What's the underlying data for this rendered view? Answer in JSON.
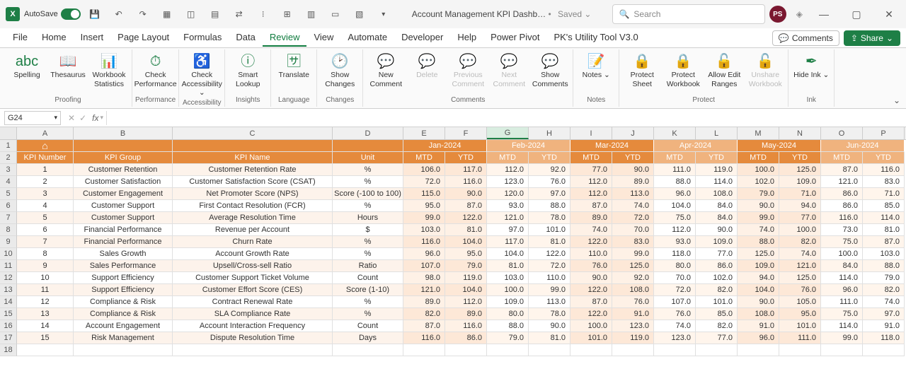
{
  "titlebar": {
    "autosave": "AutoSave",
    "doc": "Account Management KPI Dashb…",
    "saved": "Saved",
    "search_placeholder": "Search",
    "avatar": "PS"
  },
  "tabs": [
    "File",
    "Home",
    "Insert",
    "Page Layout",
    "Formulas",
    "Data",
    "Review",
    "View",
    "Automate",
    "Developer",
    "Help",
    "Power Pivot",
    "PK's Utility Tool V3.0"
  ],
  "active_tab": "Review",
  "right_actions": {
    "comments": "Comments",
    "share": "Share"
  },
  "ribbon": {
    "groups": [
      {
        "label": "Proofing",
        "items": [
          {
            "name": "spelling-button",
            "label": "Spelling",
            "icon": "abc"
          },
          {
            "name": "thesaurus-button",
            "label": "Thesaurus",
            "icon": "📖"
          },
          {
            "name": "workbook-stats-button",
            "label": "Workbook Statistics",
            "icon": "📊"
          }
        ]
      },
      {
        "label": "Performance",
        "items": [
          {
            "name": "check-performance-button",
            "label": "Check Performance",
            "icon": "⏱"
          }
        ]
      },
      {
        "label": "Accessibility",
        "items": [
          {
            "name": "check-accessibility-button",
            "label": "Check Accessibility ⌄",
            "icon": "♿"
          }
        ]
      },
      {
        "label": "Insights",
        "items": [
          {
            "name": "smart-lookup-button",
            "label": "Smart Lookup",
            "icon": "ⓘ"
          }
        ]
      },
      {
        "label": "Language",
        "items": [
          {
            "name": "translate-button",
            "label": "Translate",
            "icon": "🈂"
          }
        ]
      },
      {
        "label": "Changes",
        "items": [
          {
            "name": "show-changes-button",
            "label": "Show Changes",
            "icon": "🕑"
          }
        ]
      },
      {
        "label": "Comments",
        "items": [
          {
            "name": "new-comment-button",
            "label": "New Comment",
            "icon": "💬"
          },
          {
            "name": "delete-comment-button",
            "label": "Delete",
            "icon": "💬",
            "disabled": true
          },
          {
            "name": "previous-comment-button",
            "label": "Previous Comment",
            "icon": "💬",
            "disabled": true
          },
          {
            "name": "next-comment-button",
            "label": "Next Comment",
            "icon": "💬",
            "disabled": true
          },
          {
            "name": "show-comments-button",
            "label": "Show Comments",
            "icon": "💬"
          }
        ]
      },
      {
        "label": "Notes",
        "items": [
          {
            "name": "notes-button",
            "label": "Notes ⌄",
            "icon": "📝"
          }
        ]
      },
      {
        "label": "Protect",
        "items": [
          {
            "name": "protect-sheet-button",
            "label": "Protect Sheet",
            "icon": "🔒"
          },
          {
            "name": "protect-workbook-button",
            "label": "Protect Workbook",
            "icon": "🔒"
          },
          {
            "name": "allow-edit-ranges-button",
            "label": "Allow Edit Ranges",
            "icon": "🔓"
          },
          {
            "name": "unshare-workbook-button",
            "label": "Unshare Workbook",
            "icon": "🔓",
            "disabled": true
          }
        ]
      },
      {
        "label": "Ink",
        "items": [
          {
            "name": "hide-ink-button",
            "label": "Hide Ink ⌄",
            "icon": "✒"
          }
        ]
      }
    ]
  },
  "namebox": "G24",
  "columns": [
    "A",
    "B",
    "C",
    "D",
    "E",
    "F",
    "G",
    "H",
    "I",
    "J",
    "K",
    "L",
    "M",
    "N",
    "O",
    "P"
  ],
  "selected_col": "G",
  "months": [
    "Jan-2024",
    "Feb-2024",
    "Mar-2024",
    "Apr-2024",
    "May-2024",
    "Jun-2024"
  ],
  "headers2_left": [
    "KPI Number",
    "KPI Group",
    "KPI Name",
    "Unit"
  ],
  "headers2_right_pair": [
    "MTD",
    "YTD"
  ],
  "rows": [
    {
      "n": "1",
      "g": "Customer Retention",
      "k": "Customer Retention Rate",
      "u": "%",
      "v": [
        "106.0",
        "117.0",
        "112.0",
        "92.0",
        "77.0",
        "90.0",
        "111.0",
        "119.0",
        "100.0",
        "125.0",
        "87.0",
        "116.0"
      ]
    },
    {
      "n": "2",
      "g": "Customer Satisfaction",
      "k": "Customer Satisfaction Score (CSAT)",
      "u": "%",
      "v": [
        "72.0",
        "116.0",
        "123.0",
        "76.0",
        "112.0",
        "89.0",
        "88.0",
        "114.0",
        "102.0",
        "109.0",
        "121.0",
        "83.0"
      ]
    },
    {
      "n": "3",
      "g": "Customer Engagement",
      "k": "Net Promoter Score (NPS)",
      "u": "Score (-100 to 100)",
      "v": [
        "115.0",
        "90.0",
        "120.0",
        "97.0",
        "112.0",
        "113.0",
        "96.0",
        "108.0",
        "79.0",
        "71.0",
        "86.0",
        "71.0"
      ]
    },
    {
      "n": "4",
      "g": "Customer Support",
      "k": "First Contact Resolution (FCR)",
      "u": "%",
      "v": [
        "95.0",
        "87.0",
        "93.0",
        "88.0",
        "87.0",
        "74.0",
        "104.0",
        "84.0",
        "90.0",
        "94.0",
        "86.0",
        "85.0"
      ]
    },
    {
      "n": "5",
      "g": "Customer Support",
      "k": "Average Resolution Time",
      "u": "Hours",
      "v": [
        "99.0",
        "122.0",
        "121.0",
        "78.0",
        "89.0",
        "72.0",
        "75.0",
        "84.0",
        "99.0",
        "77.0",
        "116.0",
        "114.0"
      ]
    },
    {
      "n": "6",
      "g": "Financial Performance",
      "k": "Revenue per Account",
      "u": "$",
      "v": [
        "103.0",
        "81.0",
        "97.0",
        "101.0",
        "74.0",
        "70.0",
        "112.0",
        "90.0",
        "74.0",
        "100.0",
        "73.0",
        "81.0"
      ]
    },
    {
      "n": "7",
      "g": "Financial Performance",
      "k": "Churn Rate",
      "u": "%",
      "v": [
        "116.0",
        "104.0",
        "117.0",
        "81.0",
        "122.0",
        "83.0",
        "93.0",
        "109.0",
        "88.0",
        "82.0",
        "75.0",
        "87.0"
      ]
    },
    {
      "n": "8",
      "g": "Sales Growth",
      "k": "Account Growth Rate",
      "u": "%",
      "v": [
        "96.0",
        "95.0",
        "104.0",
        "122.0",
        "110.0",
        "99.0",
        "118.0",
        "77.0",
        "125.0",
        "74.0",
        "100.0",
        "103.0"
      ]
    },
    {
      "n": "9",
      "g": "Sales Performance",
      "k": "Upsell/Cross-sell Ratio",
      "u": "Ratio",
      "v": [
        "107.0",
        "79.0",
        "81.0",
        "72.0",
        "76.0",
        "125.0",
        "80.0",
        "86.0",
        "109.0",
        "121.0",
        "84.0",
        "88.0"
      ]
    },
    {
      "n": "10",
      "g": "Support Efficiency",
      "k": "Customer Support Ticket Volume",
      "u": "Count",
      "v": [
        "98.0",
        "119.0",
        "103.0",
        "110.0",
        "90.0",
        "92.0",
        "70.0",
        "102.0",
        "94.0",
        "125.0",
        "114.0",
        "79.0"
      ]
    },
    {
      "n": "11",
      "g": "Support Efficiency",
      "k": "Customer Effort Score (CES)",
      "u": "Score (1-10)",
      "v": [
        "121.0",
        "104.0",
        "100.0",
        "99.0",
        "122.0",
        "108.0",
        "72.0",
        "82.0",
        "104.0",
        "76.0",
        "96.0",
        "82.0"
      ]
    },
    {
      "n": "12",
      "g": "Compliance & Risk",
      "k": "Contract Renewal Rate",
      "u": "%",
      "v": [
        "89.0",
        "112.0",
        "109.0",
        "113.0",
        "87.0",
        "76.0",
        "107.0",
        "101.0",
        "90.0",
        "105.0",
        "111.0",
        "74.0"
      ]
    },
    {
      "n": "13",
      "g": "Compliance & Risk",
      "k": "SLA Compliance Rate",
      "u": "%",
      "v": [
        "82.0",
        "89.0",
        "80.0",
        "78.0",
        "122.0",
        "91.0",
        "76.0",
        "85.0",
        "108.0",
        "95.0",
        "75.0",
        "97.0"
      ]
    },
    {
      "n": "14",
      "g": "Account Engagement",
      "k": "Account Interaction Frequency",
      "u": "Count",
      "v": [
        "87.0",
        "116.0",
        "88.0",
        "90.0",
        "100.0",
        "123.0",
        "74.0",
        "82.0",
        "91.0",
        "101.0",
        "114.0",
        "91.0"
      ]
    },
    {
      "n": "15",
      "g": "Risk Management",
      "k": "Dispute Resolution Time",
      "u": "Days",
      "v": [
        "116.0",
        "86.0",
        "79.0",
        "81.0",
        "101.0",
        "119.0",
        "123.0",
        "77.0",
        "96.0",
        "111.0",
        "99.0",
        "118.0"
      ]
    }
  ]
}
